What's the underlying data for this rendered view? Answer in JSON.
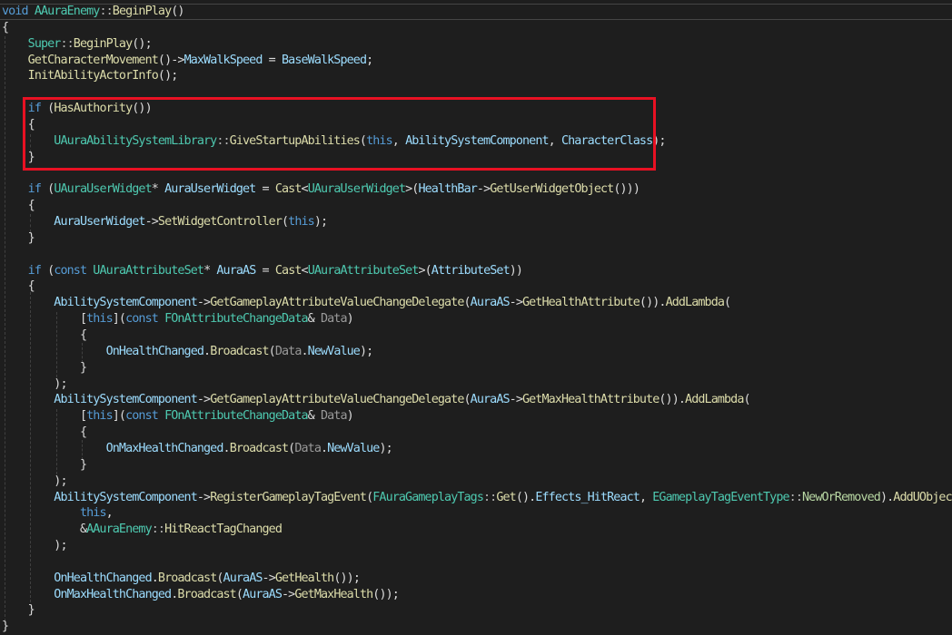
{
  "editor": {
    "language": "C++",
    "colors": {
      "background": "#1e1e1e",
      "keyword": "#569cd6",
      "type": "#4ec9b0",
      "function": "#dcdcaa",
      "variable": "#9cdcfe",
      "parameter": "#9a9a9a",
      "highlight_box": "#e81123"
    },
    "lines": [
      [
        {
          "t": "void",
          "c": "kw"
        },
        {
          "t": " "
        },
        {
          "t": "AAuraEnemy",
          "c": "ty"
        },
        {
          "t": "::",
          "c": "op"
        },
        {
          "t": "BeginPlay",
          "c": "fn"
        },
        {
          "t": "()"
        }
      ],
      [
        {
          "t": "{"
        }
      ],
      [
        {
          "t": "    "
        },
        {
          "t": "Super",
          "c": "ty"
        },
        {
          "t": "::",
          "c": "op"
        },
        {
          "t": "BeginPlay",
          "c": "fn"
        },
        {
          "t": "();"
        }
      ],
      [
        {
          "t": "    "
        },
        {
          "t": "GetCharacterMovement",
          "c": "fn"
        },
        {
          "t": "()->"
        },
        {
          "t": "MaxWalkSpeed",
          "c": "var"
        },
        {
          "t": " = "
        },
        {
          "t": "BaseWalkSpeed",
          "c": "var"
        },
        {
          "t": ";"
        }
      ],
      [
        {
          "t": "    "
        },
        {
          "t": "InitAbilityActorInfo",
          "c": "fn"
        },
        {
          "t": "();"
        }
      ],
      [
        {
          "t": ""
        }
      ],
      [
        {
          "t": "    "
        },
        {
          "t": "if",
          "c": "kw"
        },
        {
          "t": " ("
        },
        {
          "t": "HasAuthority",
          "c": "fn"
        },
        {
          "t": "())"
        }
      ],
      [
        {
          "t": "    {"
        }
      ],
      [
        {
          "t": "        "
        },
        {
          "t": "UAuraAbilitySystemLibrary",
          "c": "ty"
        },
        {
          "t": "::",
          "c": "op"
        },
        {
          "t": "GiveStartupAbilities",
          "c": "fn"
        },
        {
          "t": "("
        },
        {
          "t": "this",
          "c": "kw"
        },
        {
          "t": ", "
        },
        {
          "t": "AbilitySystemComponent",
          "c": "var"
        },
        {
          "t": ", "
        },
        {
          "t": "CharacterClass",
          "c": "var"
        },
        {
          "t": ");"
        }
      ],
      [
        {
          "t": "    }"
        }
      ],
      [
        {
          "t": ""
        }
      ],
      [
        {
          "t": "    "
        },
        {
          "t": "if",
          "c": "kw"
        },
        {
          "t": " ("
        },
        {
          "t": "UAuraUserWidget",
          "c": "ty"
        },
        {
          "t": "* "
        },
        {
          "t": "AuraUserWidget",
          "c": "var"
        },
        {
          "t": " = "
        },
        {
          "t": "Cast",
          "c": "fn"
        },
        {
          "t": "<"
        },
        {
          "t": "UAuraUserWidget",
          "c": "ty"
        },
        {
          "t": ">("
        },
        {
          "t": "HealthBar",
          "c": "var"
        },
        {
          "t": "->"
        },
        {
          "t": "GetUserWidgetObject",
          "c": "fn"
        },
        {
          "t": "()))"
        }
      ],
      [
        {
          "t": "    {"
        }
      ],
      [
        {
          "t": "        "
        },
        {
          "t": "AuraUserWidget",
          "c": "var"
        },
        {
          "t": "->"
        },
        {
          "t": "SetWidgetController",
          "c": "fn"
        },
        {
          "t": "("
        },
        {
          "t": "this",
          "c": "kw"
        },
        {
          "t": ");"
        }
      ],
      [
        {
          "t": "    }"
        }
      ],
      [
        {
          "t": ""
        }
      ],
      [
        {
          "t": "    "
        },
        {
          "t": "if",
          "c": "kw"
        },
        {
          "t": " ("
        },
        {
          "t": "const",
          "c": "kw"
        },
        {
          "t": " "
        },
        {
          "t": "UAuraAttributeSet",
          "c": "ty"
        },
        {
          "t": "* "
        },
        {
          "t": "AuraAS",
          "c": "var"
        },
        {
          "t": " = "
        },
        {
          "t": "Cast",
          "c": "fn"
        },
        {
          "t": "<"
        },
        {
          "t": "UAuraAttributeSet",
          "c": "ty"
        },
        {
          "t": ">("
        },
        {
          "t": "AttributeSet",
          "c": "var"
        },
        {
          "t": "))"
        }
      ],
      [
        {
          "t": "    {"
        }
      ],
      [
        {
          "t": "        "
        },
        {
          "t": "AbilitySystemComponent",
          "c": "var"
        },
        {
          "t": "->"
        },
        {
          "t": "GetGameplayAttributeValueChangeDelegate",
          "c": "fn"
        },
        {
          "t": "("
        },
        {
          "t": "AuraAS",
          "c": "var"
        },
        {
          "t": "->"
        },
        {
          "t": "GetHealthAttribute",
          "c": "fn"
        },
        {
          "t": "())."
        },
        {
          "t": "AddLambda",
          "c": "fn"
        },
        {
          "t": "("
        }
      ],
      [
        {
          "t": "            ["
        },
        {
          "t": "this",
          "c": "kw"
        },
        {
          "t": "]("
        },
        {
          "t": "const",
          "c": "kw"
        },
        {
          "t": " "
        },
        {
          "t": "FOnAttributeChangeData",
          "c": "ty"
        },
        {
          "t": "& "
        },
        {
          "t": "Data",
          "c": "par"
        },
        {
          "t": ")"
        }
      ],
      [
        {
          "t": "            {"
        }
      ],
      [
        {
          "t": "                "
        },
        {
          "t": "OnHealthChanged",
          "c": "var"
        },
        {
          "t": "."
        },
        {
          "t": "Broadcast",
          "c": "fn"
        },
        {
          "t": "("
        },
        {
          "t": "Data",
          "c": "par"
        },
        {
          "t": "."
        },
        {
          "t": "NewValue",
          "c": "var"
        },
        {
          "t": ");"
        }
      ],
      [
        {
          "t": "            }"
        }
      ],
      [
        {
          "t": "        );"
        }
      ],
      [
        {
          "t": "        "
        },
        {
          "t": "AbilitySystemComponent",
          "c": "var"
        },
        {
          "t": "->"
        },
        {
          "t": "GetGameplayAttributeValueChangeDelegate",
          "c": "fn"
        },
        {
          "t": "("
        },
        {
          "t": "AuraAS",
          "c": "var"
        },
        {
          "t": "->"
        },
        {
          "t": "GetMaxHealthAttribute",
          "c": "fn"
        },
        {
          "t": "())."
        },
        {
          "t": "AddLambda",
          "c": "fn"
        },
        {
          "t": "("
        }
      ],
      [
        {
          "t": "            ["
        },
        {
          "t": "this",
          "c": "kw"
        },
        {
          "t": "]("
        },
        {
          "t": "const",
          "c": "kw"
        },
        {
          "t": " "
        },
        {
          "t": "FOnAttributeChangeData",
          "c": "ty"
        },
        {
          "t": "& "
        },
        {
          "t": "Data",
          "c": "par"
        },
        {
          "t": ")"
        }
      ],
      [
        {
          "t": "            {"
        }
      ],
      [
        {
          "t": "                "
        },
        {
          "t": "OnMaxHealthChanged",
          "c": "var"
        },
        {
          "t": "."
        },
        {
          "t": "Broadcast",
          "c": "fn"
        },
        {
          "t": "("
        },
        {
          "t": "Data",
          "c": "par"
        },
        {
          "t": "."
        },
        {
          "t": "NewValue",
          "c": "var"
        },
        {
          "t": ");"
        }
      ],
      [
        {
          "t": "            }"
        }
      ],
      [
        {
          "t": "        );"
        }
      ],
      [
        {
          "t": "        "
        },
        {
          "t": "AbilitySystemComponent",
          "c": "var"
        },
        {
          "t": "->"
        },
        {
          "t": "RegisterGameplayTagEvent",
          "c": "fn"
        },
        {
          "t": "("
        },
        {
          "t": "FAuraGameplayTags",
          "c": "ty"
        },
        {
          "t": "::",
          "c": "op"
        },
        {
          "t": "Get",
          "c": "fn"
        },
        {
          "t": "()."
        },
        {
          "t": "Effects_HitReact",
          "c": "var"
        },
        {
          "t": ", "
        },
        {
          "t": "EGameplayTagEventType",
          "c": "ty"
        },
        {
          "t": "::",
          "c": "op"
        },
        {
          "t": "NewOrRemoved",
          "c": "en"
        },
        {
          "t": ")."
        },
        {
          "t": "AddUObject",
          "c": "fn"
        },
        {
          "t": "("
        }
      ],
      [
        {
          "t": "            "
        },
        {
          "t": "this",
          "c": "kw"
        },
        {
          "t": ","
        }
      ],
      [
        {
          "t": "            &"
        },
        {
          "t": "AAuraEnemy",
          "c": "ty"
        },
        {
          "t": "::",
          "c": "op"
        },
        {
          "t": "HitReactTagChanged",
          "c": "fn"
        }
      ],
      [
        {
          "t": "        );"
        }
      ],
      [
        {
          "t": ""
        }
      ],
      [
        {
          "t": "        "
        },
        {
          "t": "OnHealthChanged",
          "c": "var"
        },
        {
          "t": "."
        },
        {
          "t": "Broadcast",
          "c": "fn"
        },
        {
          "t": "("
        },
        {
          "t": "AuraAS",
          "c": "var"
        },
        {
          "t": "->"
        },
        {
          "t": "GetHealth",
          "c": "fn"
        },
        {
          "t": "());"
        }
      ],
      [
        {
          "t": "        "
        },
        {
          "t": "OnMaxHealthChanged",
          "c": "var"
        },
        {
          "t": "."
        },
        {
          "t": "Broadcast",
          "c": "fn"
        },
        {
          "t": "("
        },
        {
          "t": "AuraAS",
          "c": "var"
        },
        {
          "t": "->"
        },
        {
          "t": "GetMaxHealth",
          "c": "fn"
        },
        {
          "t": "());"
        }
      ],
      [
        {
          "t": "    }"
        }
      ],
      [
        {
          "t": "}"
        }
      ]
    ]
  }
}
